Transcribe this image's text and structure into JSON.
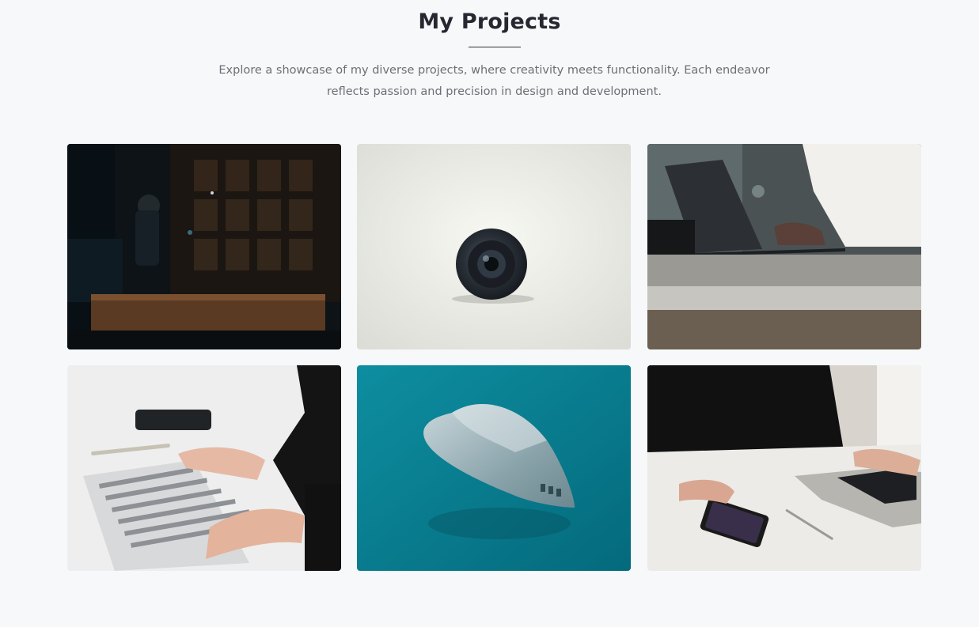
{
  "section": {
    "title": "My Projects",
    "description": "Explore a showcase of my diverse projects, where creativity meets functionality. Each endeavor reflects passion and precision in design and development."
  },
  "projects": [
    {
      "image_subject": "dark-studio-camera-photo"
    },
    {
      "image_subject": "camera-lens-photo"
    },
    {
      "image_subject": "laptop-typing-photo"
    },
    {
      "image_subject": "keyboard-hands-photo"
    },
    {
      "image_subject": "guitar-pick-photo"
    },
    {
      "image_subject": "phone-laptop-desk-photo"
    }
  ],
  "colors": {
    "background": "#f7f8fa",
    "heading": "#252830",
    "body_text": "#6c6f76"
  }
}
